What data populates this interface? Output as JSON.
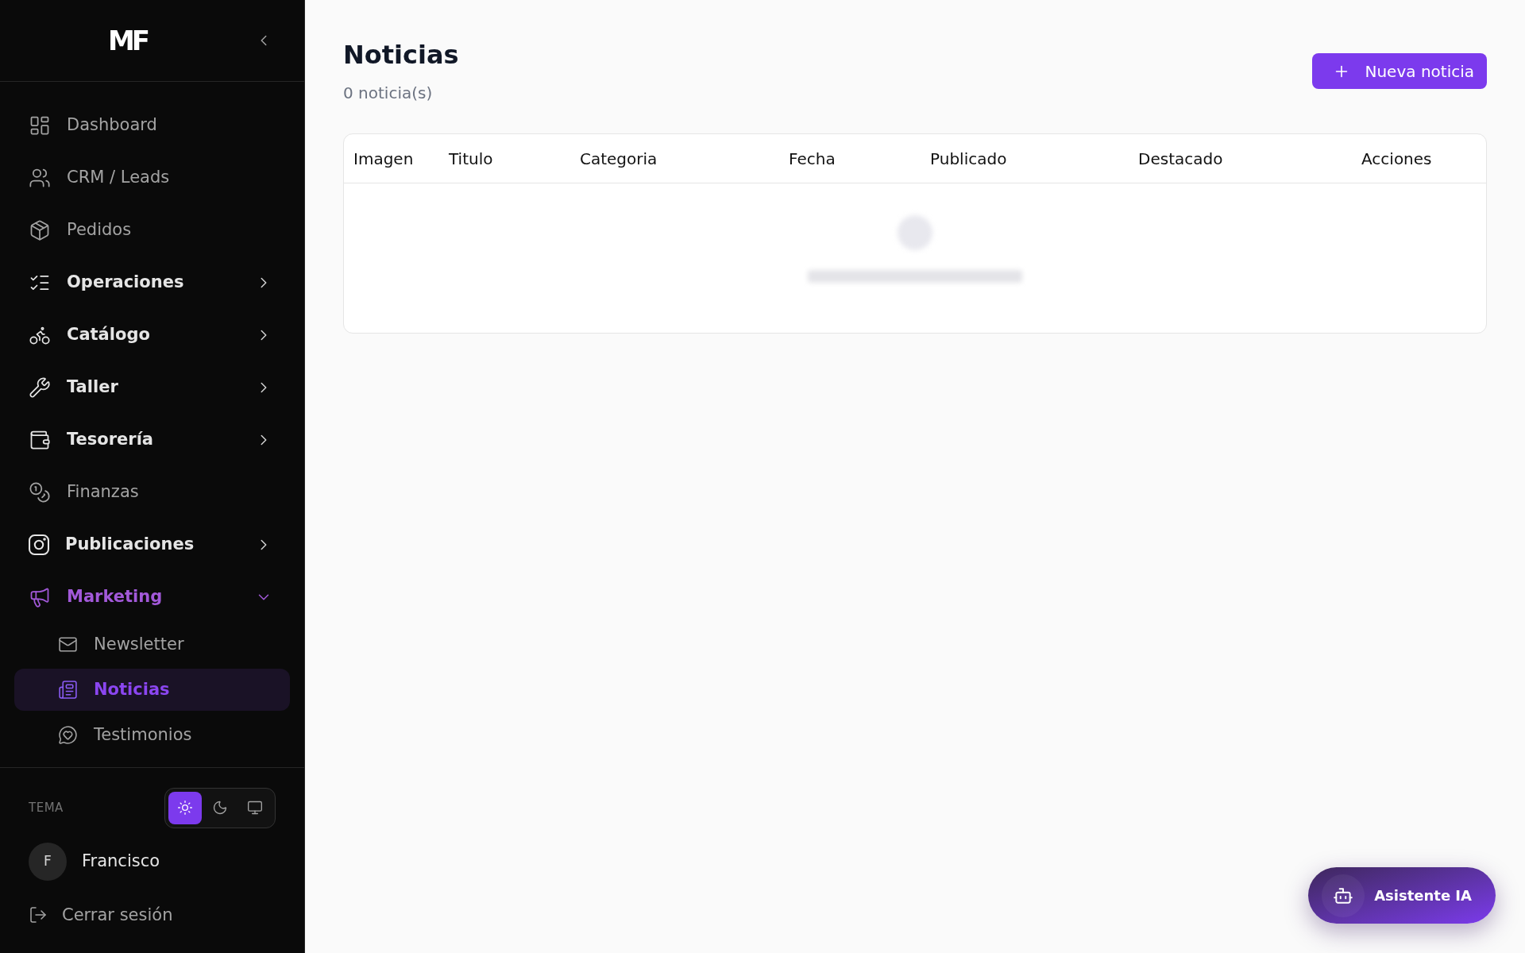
{
  "sidebar": {
    "logo": "MF",
    "nav": [
      {
        "label": "Dashboard",
        "kind": "link",
        "selected": false
      },
      {
        "label": "CRM / Leads",
        "kind": "link",
        "selected": false
      },
      {
        "label": "Pedidos",
        "kind": "link",
        "selected": false
      },
      {
        "label": "Operaciones",
        "kind": "group",
        "selected": false,
        "expanded": false
      },
      {
        "label": "Catálogo",
        "kind": "group",
        "selected": false,
        "expanded": false
      },
      {
        "label": "Taller",
        "kind": "group",
        "selected": false,
        "expanded": false
      },
      {
        "label": "Tesorería",
        "kind": "group",
        "selected": false,
        "expanded": false
      },
      {
        "label": "Finanzas",
        "kind": "link",
        "selected": false
      },
      {
        "label": "Publicaciones",
        "kind": "group",
        "selected": false,
        "expanded": false
      },
      {
        "label": "Marketing",
        "kind": "group",
        "selected": true,
        "expanded": true,
        "children": [
          {
            "label": "Newsletter",
            "selected": false
          },
          {
            "label": "Noticias",
            "selected": true
          },
          {
            "label": "Testimonios",
            "selected": false
          }
        ]
      }
    ],
    "theme": {
      "label": "TEMA",
      "options": [
        {
          "kind": "light",
          "selected": true
        },
        {
          "kind": "dark",
          "selected": false
        },
        {
          "kind": "system",
          "selected": false
        }
      ]
    },
    "user": {
      "initial": "F",
      "name": "Francisco"
    },
    "logout": "Cerrar sesión"
  },
  "page": {
    "title": "Noticias",
    "count": "0 noticia(s)",
    "new_button": "Nueva noticia"
  },
  "table": {
    "columns": [
      "Imagen",
      "Titulo",
      "Categoria",
      "Fecha",
      "Publicado",
      "Destacado",
      "Acciones"
    ]
  },
  "assistant_button": "Asistente IA"
}
